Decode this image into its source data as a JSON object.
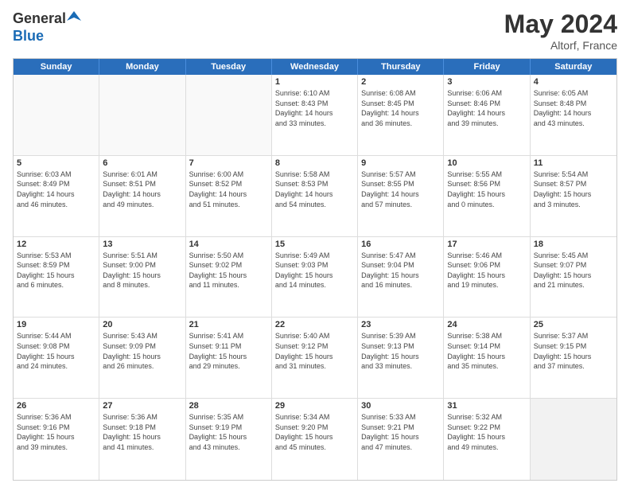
{
  "logo": {
    "general": "General",
    "blue": "Blue"
  },
  "title": {
    "month_year": "May 2024",
    "location": "Altorf, France"
  },
  "calendar": {
    "days_header": [
      "Sunday",
      "Monday",
      "Tuesday",
      "Wednesday",
      "Thursday",
      "Friday",
      "Saturday"
    ],
    "weeks": [
      [
        {
          "day": "",
          "lines": [],
          "empty": true
        },
        {
          "day": "",
          "lines": [],
          "empty": true
        },
        {
          "day": "",
          "lines": [],
          "empty": true
        },
        {
          "day": "1",
          "lines": [
            "Sunrise: 6:10 AM",
            "Sunset: 8:43 PM",
            "Daylight: 14 hours",
            "and 33 minutes."
          ]
        },
        {
          "day": "2",
          "lines": [
            "Sunrise: 6:08 AM",
            "Sunset: 8:45 PM",
            "Daylight: 14 hours",
            "and 36 minutes."
          ]
        },
        {
          "day": "3",
          "lines": [
            "Sunrise: 6:06 AM",
            "Sunset: 8:46 PM",
            "Daylight: 14 hours",
            "and 39 minutes."
          ]
        },
        {
          "day": "4",
          "lines": [
            "Sunrise: 6:05 AM",
            "Sunset: 8:48 PM",
            "Daylight: 14 hours",
            "and 43 minutes."
          ]
        }
      ],
      [
        {
          "day": "5",
          "lines": [
            "Sunrise: 6:03 AM",
            "Sunset: 8:49 PM",
            "Daylight: 14 hours",
            "and 46 minutes."
          ]
        },
        {
          "day": "6",
          "lines": [
            "Sunrise: 6:01 AM",
            "Sunset: 8:51 PM",
            "Daylight: 14 hours",
            "and 49 minutes."
          ]
        },
        {
          "day": "7",
          "lines": [
            "Sunrise: 6:00 AM",
            "Sunset: 8:52 PM",
            "Daylight: 14 hours",
            "and 51 minutes."
          ]
        },
        {
          "day": "8",
          "lines": [
            "Sunrise: 5:58 AM",
            "Sunset: 8:53 PM",
            "Daylight: 14 hours",
            "and 54 minutes."
          ]
        },
        {
          "day": "9",
          "lines": [
            "Sunrise: 5:57 AM",
            "Sunset: 8:55 PM",
            "Daylight: 14 hours",
            "and 57 minutes."
          ]
        },
        {
          "day": "10",
          "lines": [
            "Sunrise: 5:55 AM",
            "Sunset: 8:56 PM",
            "Daylight: 15 hours",
            "and 0 minutes."
          ]
        },
        {
          "day": "11",
          "lines": [
            "Sunrise: 5:54 AM",
            "Sunset: 8:57 PM",
            "Daylight: 15 hours",
            "and 3 minutes."
          ]
        }
      ],
      [
        {
          "day": "12",
          "lines": [
            "Sunrise: 5:53 AM",
            "Sunset: 8:59 PM",
            "Daylight: 15 hours",
            "and 6 minutes."
          ]
        },
        {
          "day": "13",
          "lines": [
            "Sunrise: 5:51 AM",
            "Sunset: 9:00 PM",
            "Daylight: 15 hours",
            "and 8 minutes."
          ]
        },
        {
          "day": "14",
          "lines": [
            "Sunrise: 5:50 AM",
            "Sunset: 9:02 PM",
            "Daylight: 15 hours",
            "and 11 minutes."
          ]
        },
        {
          "day": "15",
          "lines": [
            "Sunrise: 5:49 AM",
            "Sunset: 9:03 PM",
            "Daylight: 15 hours",
            "and 14 minutes."
          ]
        },
        {
          "day": "16",
          "lines": [
            "Sunrise: 5:47 AM",
            "Sunset: 9:04 PM",
            "Daylight: 15 hours",
            "and 16 minutes."
          ]
        },
        {
          "day": "17",
          "lines": [
            "Sunrise: 5:46 AM",
            "Sunset: 9:06 PM",
            "Daylight: 15 hours",
            "and 19 minutes."
          ]
        },
        {
          "day": "18",
          "lines": [
            "Sunrise: 5:45 AM",
            "Sunset: 9:07 PM",
            "Daylight: 15 hours",
            "and 21 minutes."
          ]
        }
      ],
      [
        {
          "day": "19",
          "lines": [
            "Sunrise: 5:44 AM",
            "Sunset: 9:08 PM",
            "Daylight: 15 hours",
            "and 24 minutes."
          ]
        },
        {
          "day": "20",
          "lines": [
            "Sunrise: 5:43 AM",
            "Sunset: 9:09 PM",
            "Daylight: 15 hours",
            "and 26 minutes."
          ]
        },
        {
          "day": "21",
          "lines": [
            "Sunrise: 5:41 AM",
            "Sunset: 9:11 PM",
            "Daylight: 15 hours",
            "and 29 minutes."
          ]
        },
        {
          "day": "22",
          "lines": [
            "Sunrise: 5:40 AM",
            "Sunset: 9:12 PM",
            "Daylight: 15 hours",
            "and 31 minutes."
          ]
        },
        {
          "day": "23",
          "lines": [
            "Sunrise: 5:39 AM",
            "Sunset: 9:13 PM",
            "Daylight: 15 hours",
            "and 33 minutes."
          ]
        },
        {
          "day": "24",
          "lines": [
            "Sunrise: 5:38 AM",
            "Sunset: 9:14 PM",
            "Daylight: 15 hours",
            "and 35 minutes."
          ]
        },
        {
          "day": "25",
          "lines": [
            "Sunrise: 5:37 AM",
            "Sunset: 9:15 PM",
            "Daylight: 15 hours",
            "and 37 minutes."
          ]
        }
      ],
      [
        {
          "day": "26",
          "lines": [
            "Sunrise: 5:36 AM",
            "Sunset: 9:16 PM",
            "Daylight: 15 hours",
            "and 39 minutes."
          ]
        },
        {
          "day": "27",
          "lines": [
            "Sunrise: 5:36 AM",
            "Sunset: 9:18 PM",
            "Daylight: 15 hours",
            "and 41 minutes."
          ]
        },
        {
          "day": "28",
          "lines": [
            "Sunrise: 5:35 AM",
            "Sunset: 9:19 PM",
            "Daylight: 15 hours",
            "and 43 minutes."
          ]
        },
        {
          "day": "29",
          "lines": [
            "Sunrise: 5:34 AM",
            "Sunset: 9:20 PM",
            "Daylight: 15 hours",
            "and 45 minutes."
          ]
        },
        {
          "day": "30",
          "lines": [
            "Sunrise: 5:33 AM",
            "Sunset: 9:21 PM",
            "Daylight: 15 hours",
            "and 47 minutes."
          ]
        },
        {
          "day": "31",
          "lines": [
            "Sunrise: 5:32 AM",
            "Sunset: 9:22 PM",
            "Daylight: 15 hours",
            "and 49 minutes."
          ]
        },
        {
          "day": "",
          "lines": [],
          "empty": true,
          "shaded": true
        }
      ]
    ]
  }
}
